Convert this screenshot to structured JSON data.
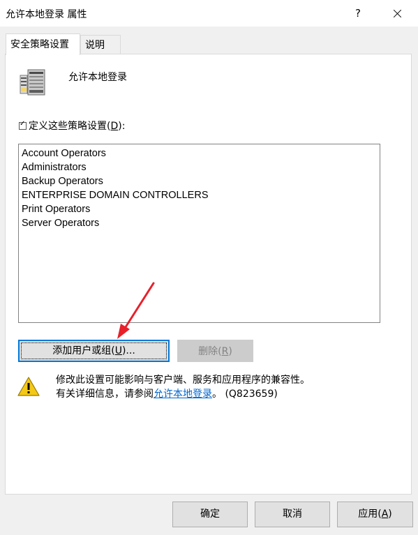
{
  "window": {
    "title": "允许本地登录 属性",
    "help_label": "?"
  },
  "tabs": [
    {
      "label": "安全策略设置",
      "active": true
    },
    {
      "label": "说明",
      "active": false
    }
  ],
  "policy": {
    "name": "允许本地登录",
    "icon": "server-icon"
  },
  "define_settings": {
    "checked": true,
    "label_prefix": "定义这些策略设置(",
    "accel": "D",
    "label_suffix": "):"
  },
  "members": [
    "Account Operators",
    "Administrators",
    "Backup Operators",
    "ENTERPRISE DOMAIN CONTROLLERS",
    "Print Operators",
    "Server Operators"
  ],
  "buttons": {
    "add_prefix": "添加用户或组(",
    "add_accel": "U",
    "add_suffix": ")...",
    "remove_prefix": "删除(",
    "remove_accel": "R",
    "remove_suffix": ")",
    "ok": "确定",
    "cancel": "取消",
    "apply_prefix": "应用(",
    "apply_accel": "A",
    "apply_suffix": ")"
  },
  "warning": {
    "icon": "warning-icon",
    "line1": "修改此设置可能影响与客户端、服务和应用程序的兼容性。",
    "line2_prefix": "有关详细信息，请参阅",
    "link": "允许本地登录",
    "line2_suffix": "。 (Q823659)"
  },
  "colors": {
    "accent": "#0078d7",
    "link": "#0066cc",
    "annotation_arrow": "#e8202a",
    "warning_yellow": "#f4c816"
  }
}
